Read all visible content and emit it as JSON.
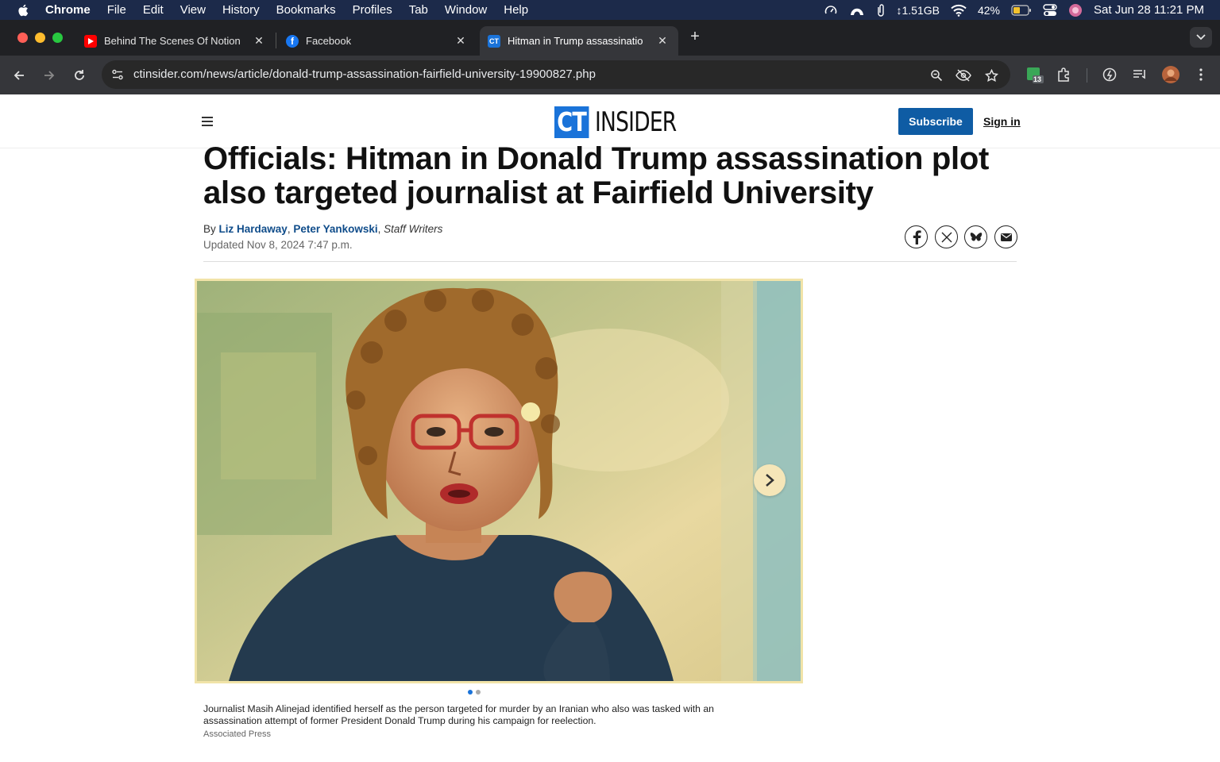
{
  "menubar": {
    "app": "Chrome",
    "items": [
      "File",
      "Edit",
      "View",
      "History",
      "Bookmarks",
      "Profiles",
      "Tab",
      "Window",
      "Help"
    ],
    "memory": "↕1.51GB",
    "battery": "42%",
    "datetime": "Sat Jun 28  11:21 PM"
  },
  "tabs": [
    {
      "title": "Behind The Scenes Of Notion",
      "favicon": "youtube-icon",
      "color": "#ff0000"
    },
    {
      "title": "Facebook",
      "favicon": "facebook-icon",
      "color": "#1877f2"
    },
    {
      "title": "Hitman in Trump assassinatio",
      "favicon": "ct-insider-icon",
      "color": "#1a73d9",
      "active": true
    }
  ],
  "address_bar": {
    "url": "ctinsider.com/news/article/donald-trump-assassination-fairfield-university-19900827.php"
  },
  "extensions": {
    "badge": "13"
  },
  "site": {
    "logo_ct": "CT",
    "logo_insider": "INSIDER",
    "subscribe": "Subscribe",
    "signin": "Sign in"
  },
  "article": {
    "headline": "Officials: Hitman in Donald Trump assassination plot also targeted journalist at Fairfield University",
    "by": "By",
    "author1": "Liz Hardaway",
    "author2": "Peter Yankowski",
    "role": "Staff Writers",
    "updated": "Updated Nov 8, 2024 7:47 p.m.",
    "share_icons": [
      "facebook-icon",
      "x-icon",
      "bluesky-icon",
      "email-icon"
    ],
    "caption": "Journalist Masih Alinejad identified herself as the person targeted for murder by an Iranian who also was tasked with an assassination attempt of former President Donald Trump during his campaign for reelection.",
    "credit": "Associated Press",
    "gallery_total": 2,
    "gallery_current": 1
  },
  "colors": {
    "menubar": "#1c2a4a",
    "chrome_dark": "#202124",
    "accent": "#1a73d9",
    "subscribe": "#0f5ca4",
    "author_link": "#0f4c8a"
  }
}
